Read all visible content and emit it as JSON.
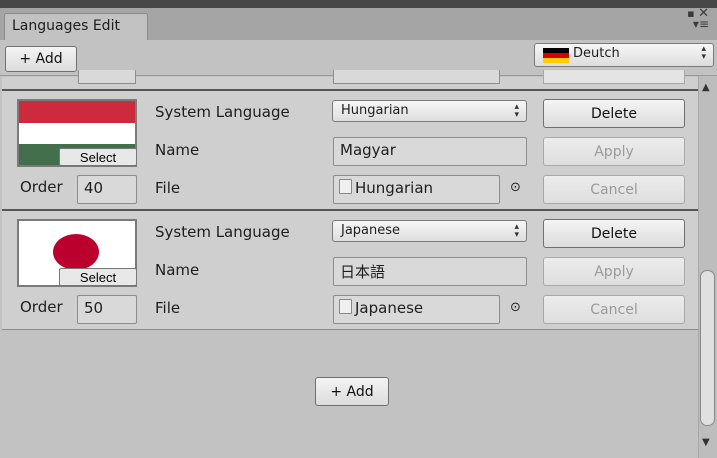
{
  "window": {
    "tab_title": "Languages Edit",
    "maximize_icon": "restore-icon",
    "close_icon": "close-icon",
    "menu_icon": "menu-icon"
  },
  "toolbar": {
    "add_label": "+ Add",
    "language_select": {
      "value": "Deutch",
      "flag": "german-flag-icon"
    }
  },
  "partial_row": {
    "field_value": ""
  },
  "entries": [
    {
      "flag": "hungarian-flag",
      "select_label": "Select",
      "order_label": "Order",
      "order_value": "40",
      "system_language_label": "System Language",
      "system_language": "Hungarian",
      "name_label": "Name",
      "name_value": "Magyar",
      "file_label": "File",
      "file_value": "Hungarian",
      "delete_label": "Delete",
      "apply_label": "Apply",
      "cancel_label": "Cancel"
    },
    {
      "flag": "japanese-flag",
      "select_label": "Select",
      "order_label": "Order",
      "order_value": "50",
      "system_language_label": "System Language",
      "system_language": "Japanese",
      "name_label": "Name",
      "name_value": "日本語",
      "file_label": "File",
      "file_value": "Japanese",
      "delete_label": "Delete",
      "apply_label": "Apply",
      "cancel_label": "Cancel"
    }
  ],
  "footer": {
    "add_label": "+ Add"
  },
  "colors": {
    "hu_red": "#cd2a3e",
    "hu_white": "#ffffff",
    "hu_green": "#436f4d",
    "jp_red": "#bc002d",
    "de_black": "#000000",
    "de_red": "#dd0000",
    "de_gold": "#ffce00"
  }
}
